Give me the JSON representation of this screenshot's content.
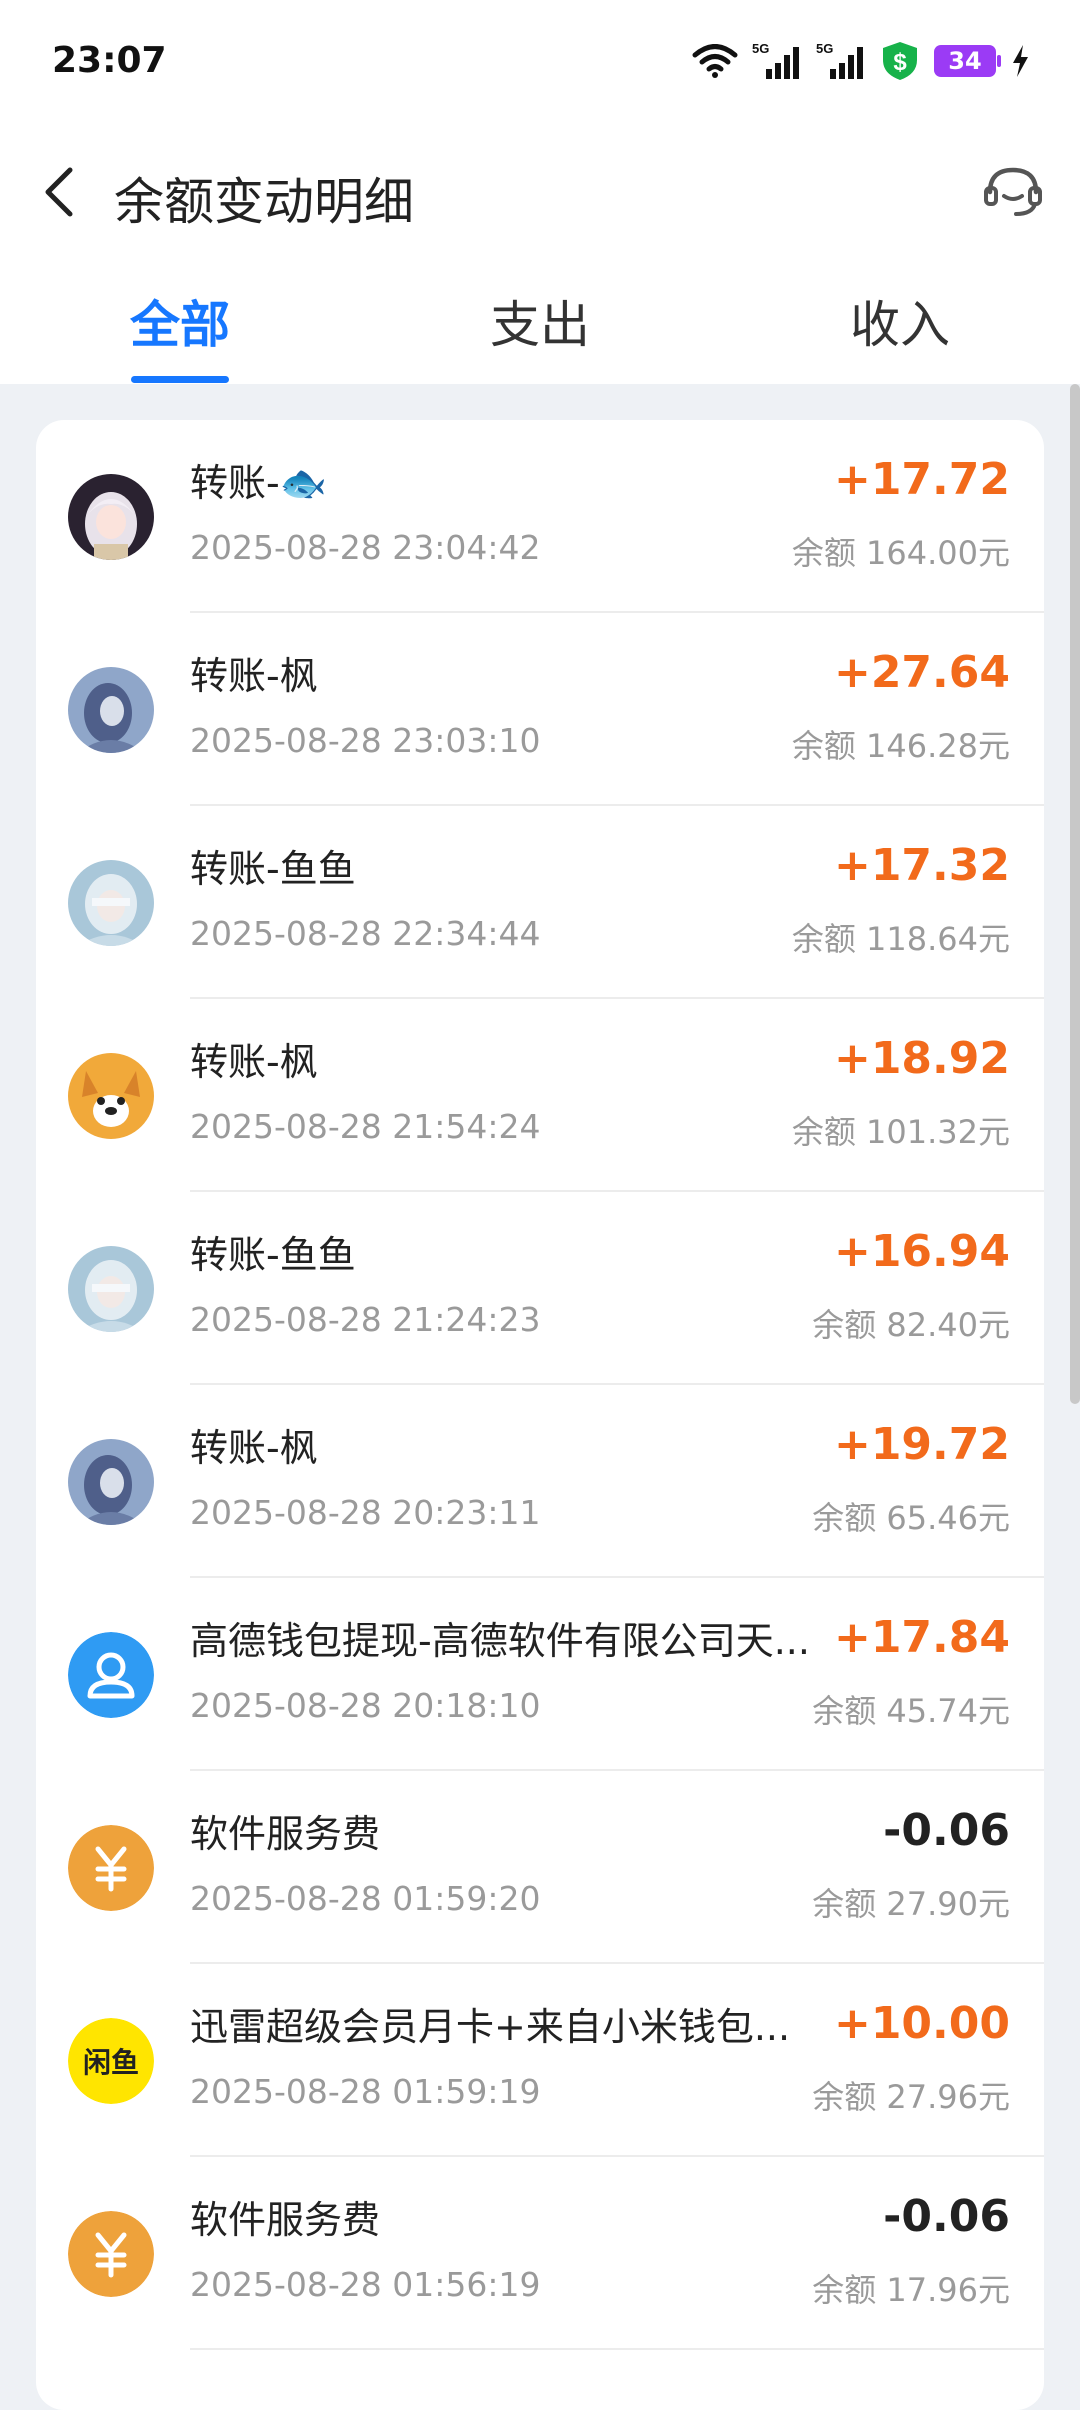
{
  "status": {
    "time": "23:07",
    "battery": "34",
    "network": [
      "5G",
      "5G"
    ]
  },
  "header": {
    "title": "余额变动明细"
  },
  "tabs": [
    {
      "label": "全部",
      "active": true
    },
    {
      "label": "支出",
      "active": false
    },
    {
      "label": "收入",
      "active": false
    }
  ],
  "transactions": [
    {
      "name": "转账-🐟",
      "date": "2025-08-28 23:04:42",
      "amount": "+17.72",
      "balance": "余额 164.00元",
      "avatar": "anime-girl-avatar"
    },
    {
      "name": "转账-枫",
      "date": "2025-08-28 23:03:10",
      "amount": "+27.64",
      "balance": "余额 146.28元",
      "avatar": "anime-portrait-avatar"
    },
    {
      "name": "转账-鱼鱼",
      "date": "2025-08-28 22:34:44",
      "amount": "+17.32",
      "balance": "余额 118.64元",
      "avatar": "anime-blindfold-avatar"
    },
    {
      "name": "转账-枫",
      "date": "2025-08-28 21:54:24",
      "amount": "+18.92",
      "balance": "余额 101.32元",
      "avatar": "corgi-avatar"
    },
    {
      "name": "转账-鱼鱼",
      "date": "2025-08-28 21:24:23",
      "amount": "+16.94",
      "balance": "余额 82.40元",
      "avatar": "anime-blindfold-avatar"
    },
    {
      "name": "转账-枫",
      "date": "2025-08-28 20:23:11",
      "amount": "+19.72",
      "balance": "余额 65.46元",
      "avatar": "anime-portrait-avatar"
    },
    {
      "name": "高德钱包提现-高德软件有限公司天...",
      "date": "2025-08-28 20:18:10",
      "amount": "+17.84",
      "balance": "余额 45.74元",
      "avatar": "user-icon"
    },
    {
      "name": "软件服务费",
      "date": "2025-08-28 01:59:20",
      "amount": "-0.06",
      "balance": "余额 27.90元",
      "avatar": "yuan-icon"
    },
    {
      "name": "迅雷超级会员月卡+来自小米钱包...",
      "date": "2025-08-28 01:59:19",
      "amount": "+10.00",
      "balance": "余额 27.96元",
      "avatar": "xianyu-logo",
      "logo_text": "闲鱼"
    },
    {
      "name": "软件服务费",
      "date": "2025-08-28 01:56:19",
      "amount": "-0.06",
      "balance": "余额 17.96元",
      "avatar": "yuan-icon"
    }
  ],
  "colors": {
    "accent": "#1677ff",
    "positive": "#f26a1b",
    "negative": "#222222"
  }
}
